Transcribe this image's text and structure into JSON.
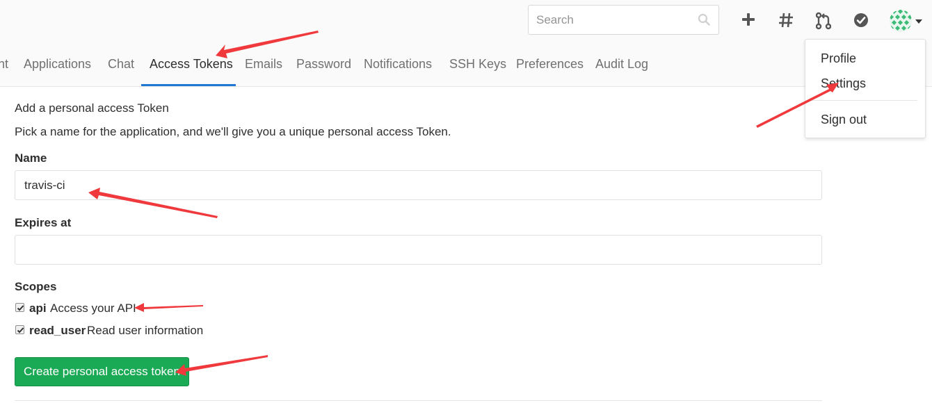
{
  "header": {
    "search_placeholder": "Search",
    "icons": [
      "search-icon",
      "plus-icon",
      "hash-icon",
      "merge-request-icon",
      "todo-check-icon",
      "avatar-identicon",
      "caret-down-icon"
    ],
    "avatar_color": "#3cba78"
  },
  "tabs": [
    {
      "label": "nt"
    },
    {
      "label": "Applications"
    },
    {
      "label": "Chat"
    },
    {
      "label": "Access Tokens",
      "active": true
    },
    {
      "label": "Emails"
    },
    {
      "label": "Password"
    },
    {
      "label": "Notifications"
    },
    {
      "label": "SSH Keys"
    },
    {
      "label": "Preferences"
    },
    {
      "label": "Audit Log"
    }
  ],
  "dropdown": {
    "items": [
      "Profile",
      "Settings",
      "Sign out"
    ]
  },
  "form": {
    "title": "Add a personal access Token",
    "description": "Pick a name for the application, and we'll give you a unique personal access Token.",
    "name_label": "Name",
    "name_value": "travis-ci",
    "expires_label": "Expires at",
    "expires_value": "",
    "scopes_label": "Scopes",
    "scopes": [
      {
        "name": "api",
        "description": "Access your API",
        "checked": true
      },
      {
        "name": "read_user",
        "description": "Read user information",
        "checked": true
      }
    ],
    "submit_label": "Create personal access token"
  },
  "colors": {
    "accent_blue": "#1f78d1",
    "button_green": "#1aaa55",
    "annotation_red": "#f0393c"
  }
}
